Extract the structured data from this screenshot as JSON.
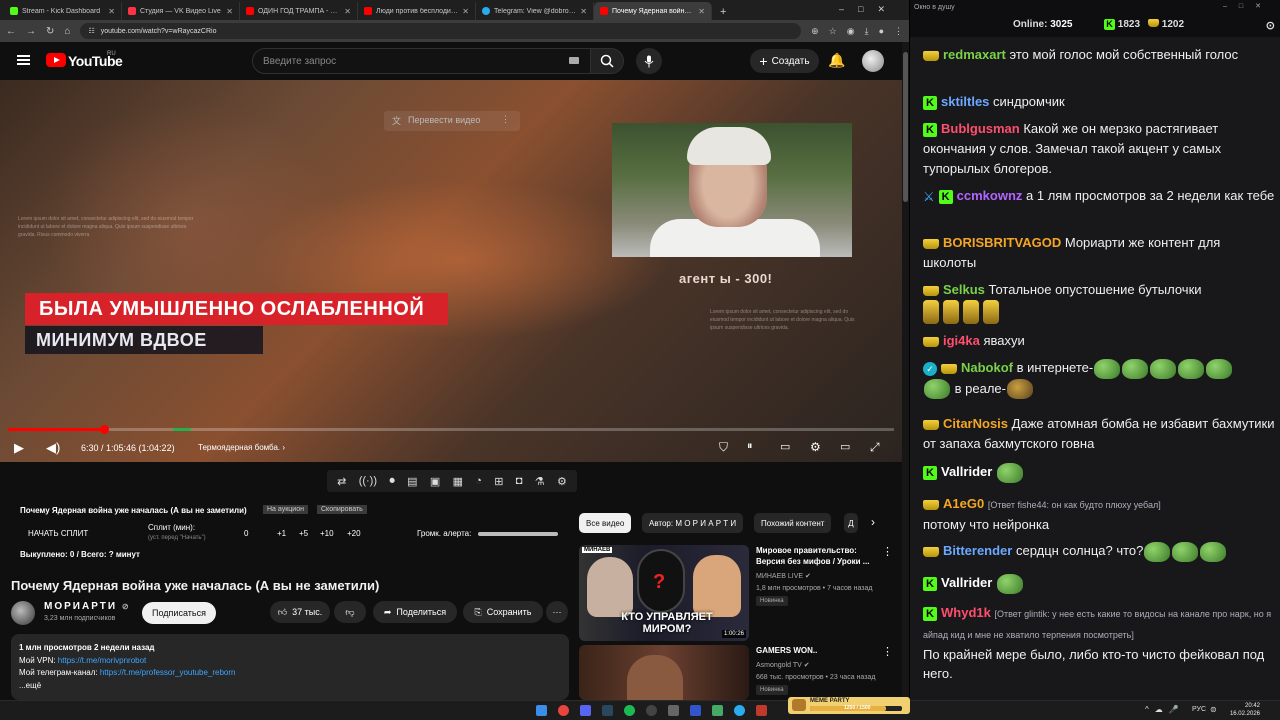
{
  "browser": {
    "tabs": [
      {
        "title": "Stream - Kick Dashboard",
        "color": "#53fc18"
      },
      {
        "title": "Студия — VK Видео Live",
        "color": "#ff3347"
      },
      {
        "title": "ОДИН ГОД ТРАМПА - YouTube",
        "color": "#ff0000"
      },
      {
        "title": "Люди против беспл­одия: семь",
        "color": "#ff0000"
      },
      {
        "title": "Telegram: View @dobro_2ch",
        "color": "#2aabee"
      },
      {
        "title": "Почему Ядерная война у...",
        "color": "#ff0000",
        "active": true
      }
    ],
    "new_tab": "+",
    "url": "youtube.com/watch?v=wRaycazCRio"
  },
  "youtube": {
    "logo_text": "YouTube",
    "country": "RU",
    "search_placeholder": "Введите запрос",
    "create_label": "Создать"
  },
  "video": {
    "translate_label": "Перевести видео",
    "overlay_agent": "агент ы - 300!",
    "lower_third_1": "БЫЛА УМЫШЛЕННО ОСЛАБЛЕННОЙ",
    "lower_third_2": "МИНИМУМ ВДВОЕ",
    "lorem_1": "Lorem ipsum dolor sit amet, consectetur adipiscing elit, sed do eiusmod tempor incididunt ut labore et dolore magna aliqua. Quis ipsum suspendisse ultrices gravida. Risus commodo viverra",
    "lorem_2": "Lorem ipsum dolor sit amet, consectetur adipiscing elit, sed do eiusmod tempor incididunt ut labore et dolore magna aliqua. Quis ipsum suspendisse ultrices gravida.",
    "progress_fraction": 0.1,
    "time": "6:30 / 1:05:46 (1:04:22)",
    "chapter": "Термоядерная бомба."
  },
  "split": {
    "row_title": "Почему Ядерная война уже началась (А вы не заметили)",
    "tag1": "На аукцион",
    "tag2": "Скопировать",
    "start_label": "НАЧАТЬ СПЛИТ",
    "split_min_label": "Сплит (мин):",
    "split_hint": "(уст. перед \"Начать\")",
    "val0": "0",
    "p1": "+1",
    "p5": "+5",
    "p10": "+10",
    "p20": "+20",
    "alert_label": "Громк. алерта:",
    "bought": "Выкуплено: 0 / Всего: ? минут"
  },
  "watch": {
    "title": "Почему Ядерная война уже началась (А вы не заметили)",
    "channel": "МОРИАРТИ",
    "subscribers": "3,23 млн подписчиков",
    "subscribe": "Подписаться",
    "likes": "37 тыс.",
    "share": "Поделиться",
    "save": "Сохранить",
    "desc_stats": "1 млн просмотров  2 недели назад",
    "desc_vpn_label": "Мой VPN: ",
    "desc_vpn_link": "https://t.me/morivpnrobot",
    "desc_tg_label": "Мой телеграм-канал: ",
    "desc_tg_link": "https://t.me/professor_youtube_reborn",
    "desc_more": "...ещё"
  },
  "recommendations": {
    "chips": [
      "Все видео",
      "Автор: М О Р И А Р Т И",
      "Похожий контент",
      "Д"
    ],
    "items": [
      {
        "title": "Мировое правительство: Версия без мифов / Уроки ...",
        "channel": "МИНАЕВ LIVE",
        "meta": "1,8 млн просмотров • 7 часов назад",
        "badge": "Новинка",
        "duration": "1:00:26",
        "thumb_tag": "МИНАЕВ",
        "thumb_text": "КТО УПРАВЛЯЕТ МИРОМ?"
      },
      {
        "title": "GAMERS WON..",
        "channel": "Asmongold TV",
        "meta": "668 тыс. просмотров • 23 часа назад",
        "badge": "Новинка"
      }
    ]
  },
  "chat": {
    "window_title": "Окно в душу",
    "online_label": "Online:",
    "online": "3025",
    "kick_count": "1823",
    "vk_count": "1202",
    "messages": [
      {
        "user": "redmaxart",
        "color": "#7bd148",
        "text": "это мой голос мой собственный голос"
      },
      {
        "user": "sktiltles",
        "color": "#6aa9ff",
        "text": "синдромчик"
      },
      {
        "user": "Bublgusman",
        "color": "#ff4f6d",
        "text": "Какой же он мерзко растягивает окончания у слов. Замечал такой акцент у самых тупорылых блогеров."
      },
      {
        "user": "ccmkownz",
        "color": "#b266ff",
        "text": "а 1 лям просмотров за 2 недели как тебе"
      },
      {
        "user": "BORISBRITVAGOD",
        "color": "#f5a623",
        "text": "Мориарти же контент для школоты"
      },
      {
        "user": "Selkus",
        "color": "#7bd148",
        "text": "Тотальное опустошение бутылочки"
      },
      {
        "user": "igi4ka",
        "color": "#ff4f6d",
        "text": "явахуи"
      },
      {
        "user": "Nabokof",
        "color": "#7bd148",
        "text": "в интернете-",
        "text2": "в реале-"
      },
      {
        "user": "CitarNosis",
        "color": "#f5a623",
        "text": "Даже атомная бомба не избавит бахмутики от запаха бахмутского говна"
      },
      {
        "user": "Vallrider",
        "color": "#ffffff",
        "text": ""
      },
      {
        "user": "A1eG0",
        "color": "#f5a623",
        "reply": "[Ответ fishe44: он как будто плюху уебал]",
        "text": "потому что нейронка"
      },
      {
        "user": "Bitterender",
        "color": "#6aa9ff",
        "text": "сердцн солнца? что?"
      },
      {
        "user": "Vallrider",
        "color": "#ffffff",
        "text": ""
      },
      {
        "user": "Whyd1k",
        "color": "#ff4f6d",
        "reply": "[Ответ glintik: у нее есть какие то видосы на канале про нарк, но я айпад кид и мне не хватило терпения посмотреть]",
        "text": "По крайней мере было, либо кто-то чисто фейковал под него."
      }
    ]
  },
  "taskbar": {
    "lang": "РУС",
    "time": "20:42",
    "date": "16.02.2026",
    "meme_party": "MEME PARTY",
    "meme_count": "1250 / 1500"
  }
}
